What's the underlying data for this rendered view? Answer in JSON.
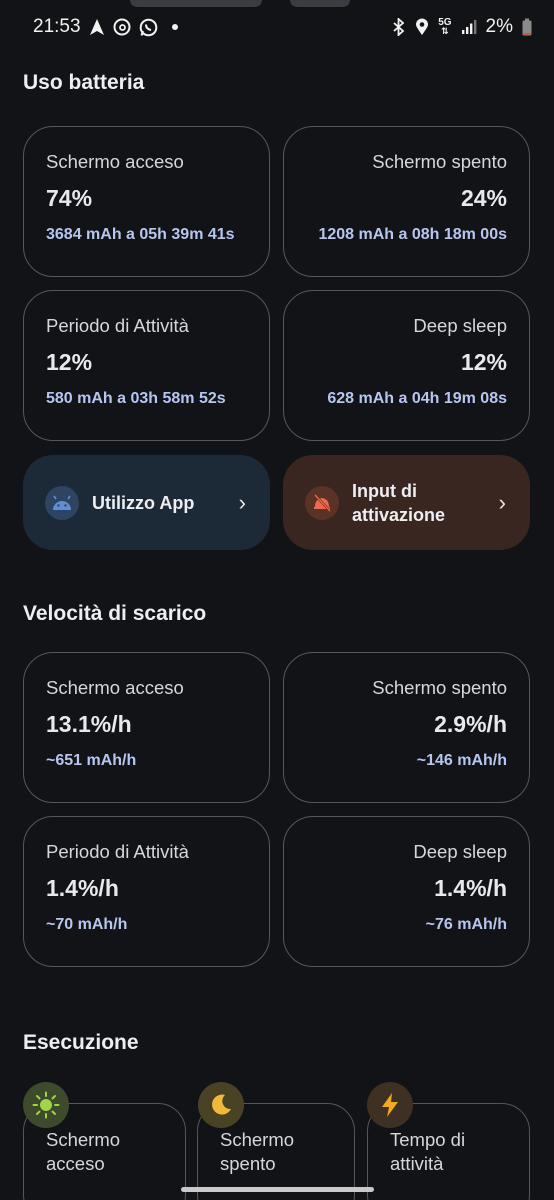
{
  "status_bar": {
    "time": "21:53",
    "network": "5G",
    "battery": "2%",
    "icons_left": [
      "navigation-icon",
      "threads-icon",
      "whatsapp-icon",
      "dot"
    ],
    "icons_right": [
      "bluetooth-icon",
      "location-icon",
      "5g-icon",
      "signal-icon",
      "battery-icon"
    ]
  },
  "battery_usage": {
    "title": "Uso batteria",
    "cards": [
      {
        "label": "Schermo acceso",
        "value": "74%",
        "sub": "3684 mAh a 05h 39m 41s"
      },
      {
        "label": "Schermo spento",
        "value": "24%",
        "sub": "1208 mAh a 08h 18m 00s"
      },
      {
        "label": "Periodo di Attività",
        "value": "12%",
        "sub": "580 mAh a 03h 58m 52s"
      },
      {
        "label": "Deep sleep",
        "value": "12%",
        "sub": "628 mAh a 04h 19m 08s"
      }
    ]
  },
  "actions": {
    "app_usage": "Utilizzo App",
    "wakeup_input": "Input di attivazione",
    "chevron": "›"
  },
  "discharge_speed": {
    "title": "Velocità di scarico",
    "cards": [
      {
        "label": "Schermo acceso",
        "value": "13.1%/h",
        "sub": "~651 mAh/h"
      },
      {
        "label": "Schermo spento",
        "value": "2.9%/h",
        "sub": "~146 mAh/h"
      },
      {
        "label": "Periodo di Attività",
        "value": "1.4%/h",
        "sub": "~70 mAh/h"
      },
      {
        "label": "Deep sleep",
        "value": "1.4%/h",
        "sub": "~76 mAh/h"
      }
    ]
  },
  "execution": {
    "title": "Esecuzione",
    "items": [
      {
        "label": "Schermo acceso",
        "icon": "sun-icon"
      },
      {
        "label": "Schermo spento",
        "icon": "moon-icon"
      },
      {
        "label": "Tempo di attività",
        "icon": "bolt-icon"
      }
    ]
  },
  "colors": {
    "background": "#121316",
    "card_border": "#55575e",
    "sub_text": "#b6c6f0",
    "app_usage_bg": "#1c2a38",
    "wakeup_bg": "#3a2620",
    "wakeup_icon": "#ef6a4c",
    "android_icon": "#4b7fc4"
  }
}
